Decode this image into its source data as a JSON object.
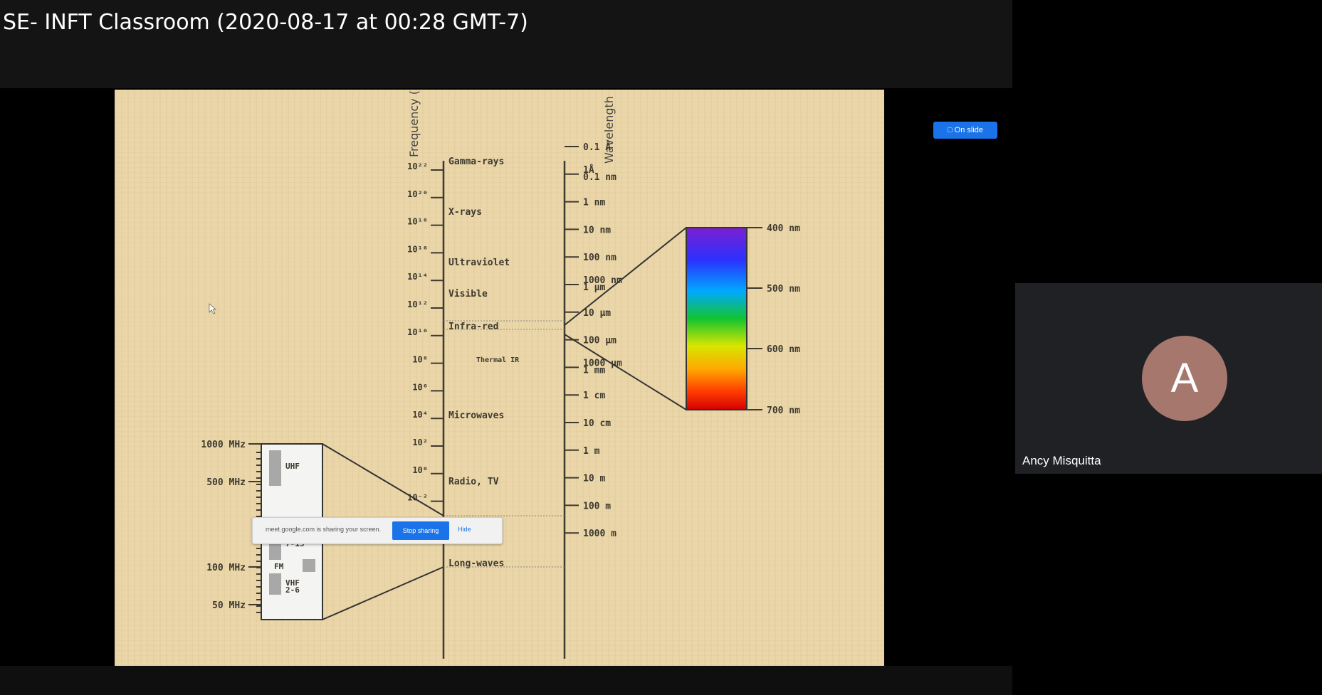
{
  "window": {
    "title": "SE- INFT Classroom (2020-08-17 at 00:28 GMT-7)"
  },
  "slide": {
    "axis_titles": {
      "frequency": "Frequency (Hz)",
      "wavelength": "Wavelength"
    },
    "frequency_ticks": [
      "10²²",
      "10²⁰",
      "10¹⁸",
      "10¹⁶",
      "10¹⁴",
      "10¹²",
      "10¹⁰",
      "10⁸",
      "10⁶",
      "10⁴",
      "10²",
      "10⁰",
      "10⁻²"
    ],
    "bands": [
      "Gamma-rays",
      "X-rays",
      "Ultraviolet",
      "Visible",
      "Infra-red",
      "Thermal IR",
      "Microwaves",
      "Radio, TV",
      "Long-waves"
    ],
    "wavelength_ticks": [
      "0.1 Å",
      "1Å 0.1 nm",
      "1 nm",
      "10 nm",
      "100 nm",
      "1000 nm 1 µm",
      "10 µm",
      "100 µm",
      "1000 µm 1 mm",
      "1 cm",
      "10 cm",
      "1 m",
      "10 m",
      "100 m",
      "1000 m"
    ],
    "visible_ticks": [
      "400 nm",
      "500 nm",
      "600 nm",
      "700 nm"
    ],
    "radio_ticks": [
      "1000 MHz",
      "500 MHz",
      "100 MHz",
      "50 MHz"
    ],
    "radio_bands": [
      "UHF",
      "VHF 7-13",
      "FM",
      "VHF 2-6"
    ]
  },
  "share_banner": {
    "message": "meet.google.com is sharing your screen.",
    "stop_label": "Stop sharing",
    "hide_label": "Hide"
  },
  "badge": {
    "label": "On slide"
  },
  "participant": {
    "initial": "A",
    "name": "Ancy Misquitta",
    "avatar_color": "#a5776d"
  }
}
